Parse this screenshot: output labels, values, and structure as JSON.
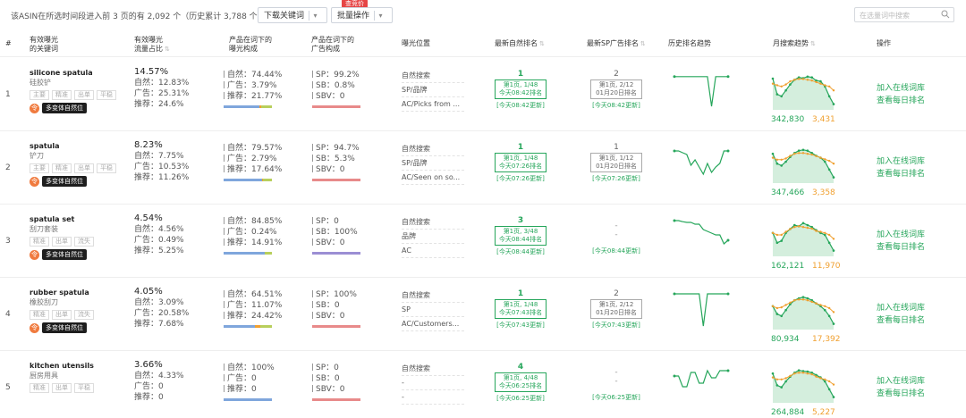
{
  "colors": {
    "green": "#26a65b",
    "orange": "#f0a030",
    "blue": "#7fa6dc",
    "purple": "#9b8ed4",
    "red": "#e88a8a",
    "yellowgreen": "#b8cf5c"
  },
  "summary": "该ASIN在所选时间段进入前 3 页的有 2,092 个（历史累计 3,788 个）",
  "buttons": {
    "download": "下载关键词",
    "batch": "批量操作",
    "hot": "查竞价"
  },
  "search": {
    "placeholder": "在选量词中搜索"
  },
  "headers": {
    "idx": "#",
    "kw_l1": "有效曝光",
    "kw_l2": "的关键词",
    "tr_l1": "有效曝光",
    "tr_l2": "流量占比",
    "comp_l1": "产品在词下的",
    "comp_l2": "曝光构成",
    "ad_l1": "产品在词下的",
    "ad_l2": "广告构成",
    "pos": "曝光位置",
    "rank": "最新自然排名",
    "sp": "最新SP广告排名",
    "hist": "历史排名趋势",
    "trend": "月搜索趋势",
    "ops": "操作"
  },
  "rows": [
    {
      "idx": "1",
      "keyword": "silicone spatula",
      "sub": "硅胶铲",
      "tags": [
        "主要",
        "精准",
        "出单",
        "平稳"
      ],
      "variant": "多变体自然位",
      "traffic": {
        "main": "14.57%",
        "natural": "自然：12.83%",
        "ad": "广告：25.31%",
        "rec": "推荐：24.6%"
      },
      "comp": [
        "自然：74.44%",
        "广告：3.79%",
        "推荐：21.77%"
      ],
      "comp_bar": [
        74.44,
        3.79,
        21.77
      ],
      "ad": [
        "SP：99.2%",
        "SB：0.8%",
        "SBV：0"
      ],
      "pos": [
        "自然搜索",
        "SP/品牌",
        "AC/Picks from ..."
      ],
      "rank": {
        "n": "1",
        "box1": "第1页, 1/48",
        "box2": "今天08:42排名",
        "upd": "[今天08:42更新]"
      },
      "sp": {
        "n": "2",
        "box1": "第1页, 2/12",
        "box2": "01月20日排名",
        "upd": "[今天08:42更新]",
        "has": true
      },
      "hist": [
        0.12,
        0.12,
        0.12,
        0.12,
        0.12,
        0.12,
        0.12,
        0.12,
        0.12,
        0.95,
        0.12,
        0.12,
        0.12,
        0.12
      ],
      "trend": {
        "left": "342,830",
        "right": "3,431",
        "g": [
          0.75,
          0.35,
          0.3,
          0.45,
          0.6,
          0.72,
          0.78,
          0.76,
          0.8,
          0.78,
          0.7,
          0.68,
          0.55,
          0.3,
          0.1
        ],
        "o": [
          0.62,
          0.58,
          0.55,
          0.6,
          0.68,
          0.72,
          0.74,
          0.74,
          0.72,
          0.7,
          0.66,
          0.62,
          0.58,
          0.55,
          0.45
        ]
      },
      "ops": [
        "加入在线词库",
        "查看每日排名"
      ]
    },
    {
      "idx": "2",
      "keyword": "spatula",
      "sub": "铲刀",
      "tags": [
        "主要",
        "精准",
        "出单",
        "平稳"
      ],
      "variant": "多变体自然位",
      "traffic": {
        "main": "8.23%",
        "natural": "自然：7.75%",
        "ad": "广告：10.53%",
        "rec": "推荐：11.26%"
      },
      "comp": [
        "自然：79.57%",
        "广告：2.79%",
        "推荐：17.64%"
      ],
      "comp_bar": [
        79.57,
        2.79,
        17.64
      ],
      "ad": [
        "SP：94.7%",
        "SB：5.3%",
        "SBV：0"
      ],
      "pos": [
        "自然搜索",
        "SP/品牌",
        "AC/Seen on so..."
      ],
      "rank": {
        "n": "1",
        "box1": "第1页, 1/48",
        "box2": "今天07:26排名",
        "upd": "[今天07:26更新]"
      },
      "sp": {
        "n": "1",
        "box1": "第1页, 1/12",
        "box2": "01月20日排名",
        "upd": "[今天07:26更新]",
        "has": true
      },
      "hist": [
        0.15,
        0.15,
        0.2,
        0.25,
        0.55,
        0.4,
        0.6,
        0.8,
        0.5,
        0.75,
        0.6,
        0.5,
        0.15,
        0.15
      ],
      "trend": {
        "left": "347,466",
        "right": "3,358",
        "g": [
          0.7,
          0.45,
          0.4,
          0.5,
          0.62,
          0.72,
          0.78,
          0.8,
          0.78,
          0.72,
          0.65,
          0.6,
          0.5,
          0.3,
          0.1
        ],
        "o": [
          0.6,
          0.55,
          0.55,
          0.58,
          0.65,
          0.7,
          0.72,
          0.72,
          0.7,
          0.68,
          0.64,
          0.6,
          0.56,
          0.52,
          0.45
        ]
      },
      "ops": [
        "加入在线词库",
        "查看每日排名"
      ]
    },
    {
      "idx": "3",
      "keyword": "spatula set",
      "sub": "刮刀套装",
      "tags": [
        "精准",
        "出单",
        "流失"
      ],
      "variant": "多变体自然位",
      "traffic": {
        "main": "4.54%",
        "natural": "自然：4.56%",
        "ad": "广告：0.49%",
        "rec": "推荐：5.25%"
      },
      "comp": [
        "自然：84.85%",
        "广告：0.24%",
        "推荐：14.91%"
      ],
      "comp_bar": [
        84.85,
        0.24,
        14.91
      ],
      "ad": [
        "SP：0",
        "SB：100%",
        "SBV：0"
      ],
      "pos": [
        "自然搜索",
        "品牌",
        "AC"
      ],
      "rank": {
        "n": "3",
        "box1": "第1页, 3/48",
        "box2": "今天08:44排名",
        "upd": "[今天08:44更新]"
      },
      "sp": {
        "n": "-",
        "box1": "",
        "box2": "",
        "upd": "[今天08:44更新]",
        "has": false
      },
      "hist": [
        0.05,
        0.05,
        0.08,
        0.1,
        0.1,
        0.15,
        0.15,
        0.3,
        0.35,
        0.4,
        0.45,
        0.45,
        0.7,
        0.6
      ],
      "trend": {
        "left": "162,121",
        "right": "11,970",
        "g": [
          0.55,
          0.3,
          0.35,
          0.55,
          0.65,
          0.75,
          0.72,
          0.8,
          0.75,
          0.7,
          0.62,
          0.55,
          0.5,
          0.3,
          0.1
        ],
        "o": [
          0.55,
          0.5,
          0.5,
          0.58,
          0.65,
          0.7,
          0.72,
          0.7,
          0.68,
          0.66,
          0.6,
          0.58,
          0.55,
          0.5,
          0.4
        ]
      },
      "ops": [
        "加入在线词库",
        "查看每日排名"
      ]
    },
    {
      "idx": "4",
      "keyword": "rubber spatula",
      "sub": "橡胶刮刀",
      "tags": [
        "精准",
        "出单",
        "流失"
      ],
      "variant": "多变体自然位",
      "traffic": {
        "main": "4.05%",
        "natural": "自然：3.09%",
        "ad": "广告：20.58%",
        "rec": "推荐：7.68%"
      },
      "comp": [
        "自然：64.51%",
        "广告：11.07%",
        "推荐：24.42%"
      ],
      "comp_bar": [
        64.51,
        11.07,
        24.42
      ],
      "ad": [
        "SP：100%",
        "SB：0",
        "SBV：0"
      ],
      "pos": [
        "自然搜索",
        "SP",
        "AC/Customers..."
      ],
      "rank": {
        "n": "1",
        "box1": "第1页, 1/48",
        "box2": "今天07:43排名",
        "upd": "[今天07:43更新]"
      },
      "sp": {
        "n": "2",
        "box1": "第1页, 2/12",
        "box2": "01月20日排名",
        "upd": "[今天07:43更新]",
        "has": true
      },
      "hist": [
        0.05,
        0.05,
        0.05,
        0.05,
        0.05,
        0.05,
        0.05,
        0.95,
        0.05,
        0.05,
        0.05,
        0.05,
        0.05,
        0.05
      ],
      "trend": {
        "left": "80,934",
        "right": "17,392",
        "g": [
          0.55,
          0.35,
          0.3,
          0.45,
          0.6,
          0.7,
          0.75,
          0.78,
          0.75,
          0.7,
          0.62,
          0.55,
          0.45,
          0.3,
          0.1
        ],
        "o": [
          0.55,
          0.5,
          0.52,
          0.58,
          0.64,
          0.7,
          0.72,
          0.72,
          0.7,
          0.66,
          0.62,
          0.58,
          0.55,
          0.5,
          0.4
        ]
      },
      "ops": [
        "加入在线词库",
        "查看每日排名"
      ]
    },
    {
      "idx": "5",
      "keyword": "kitchen utensils",
      "sub": "厨房用具",
      "tags": [
        "精准",
        "出单",
        "平稳"
      ],
      "variant": "",
      "traffic": {
        "main": "3.66%",
        "natural": "自然：4.33%",
        "ad": "广告：0",
        "rec": "推荐：0"
      },
      "comp": [
        "自然：100%",
        "广告：0",
        "推荐：0"
      ],
      "comp_bar": [
        100,
        0,
        0
      ],
      "ad": [
        "SP：0",
        "SB：0",
        "SBV：0"
      ],
      "pos": [
        "自然搜索",
        "-",
        "-"
      ],
      "rank": {
        "n": "4",
        "box1": "第1页, 4/48",
        "box2": "今天06:25排名",
        "upd": "[今天06:25更新]"
      },
      "sp": {
        "n": "-",
        "box1": "",
        "box2": "",
        "upd": "[今天06:25更新]",
        "has": false
      },
      "hist": [
        0.3,
        0.3,
        0.6,
        0.6,
        0.2,
        0.2,
        0.5,
        0.5,
        0.15,
        0.35,
        0.35,
        0.15,
        0.15,
        0.15
      ],
      "trend": {
        "left": "264,884",
        "right": "5,227",
        "g": [
          0.7,
          0.4,
          0.35,
          0.5,
          0.62,
          0.72,
          0.78,
          0.76,
          0.75,
          0.72,
          0.66,
          0.6,
          0.5,
          0.3,
          0.1
        ],
        "o": [
          0.6,
          0.55,
          0.55,
          0.58,
          0.64,
          0.7,
          0.72,
          0.72,
          0.7,
          0.68,
          0.62,
          0.58,
          0.55,
          0.5,
          0.42
        ]
      },
      "ops": [
        "加入在线词库",
        "查看每日排名"
      ]
    }
  ]
}
